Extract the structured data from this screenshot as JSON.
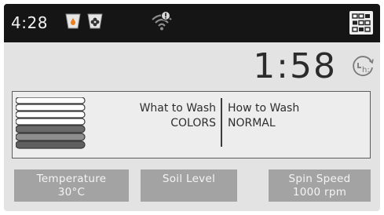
{
  "status_bar": {
    "time": "4:28",
    "icons": [
      "detergent-drop-icon",
      "softener-flower-icon",
      "wifi-alert-icon"
    ],
    "menu_icon": "grid-menu-icon"
  },
  "timer": {
    "remaining": "1:58",
    "delay_icon": "delay-start-clock-icon",
    "delay_glyph": "h:"
  },
  "cycle": {
    "what_label": "What to Wash",
    "what_value": "COLORS",
    "how_label": "How to Wash",
    "how_value": "NORMAL",
    "icon": "folded-clothes-stack-icon"
  },
  "options": [
    {
      "label": "Temperature",
      "value": "30°C"
    },
    {
      "label": "Soil Level",
      "value": ""
    },
    {
      "label": "Spin Speed",
      "value": "1000 rpm"
    }
  ],
  "colors": {
    "status_bar_bg": "#151515",
    "screen_bg": "#e3e3e3",
    "button_bg": "#a3a3a3",
    "text_dark": "#2b2b2b"
  }
}
